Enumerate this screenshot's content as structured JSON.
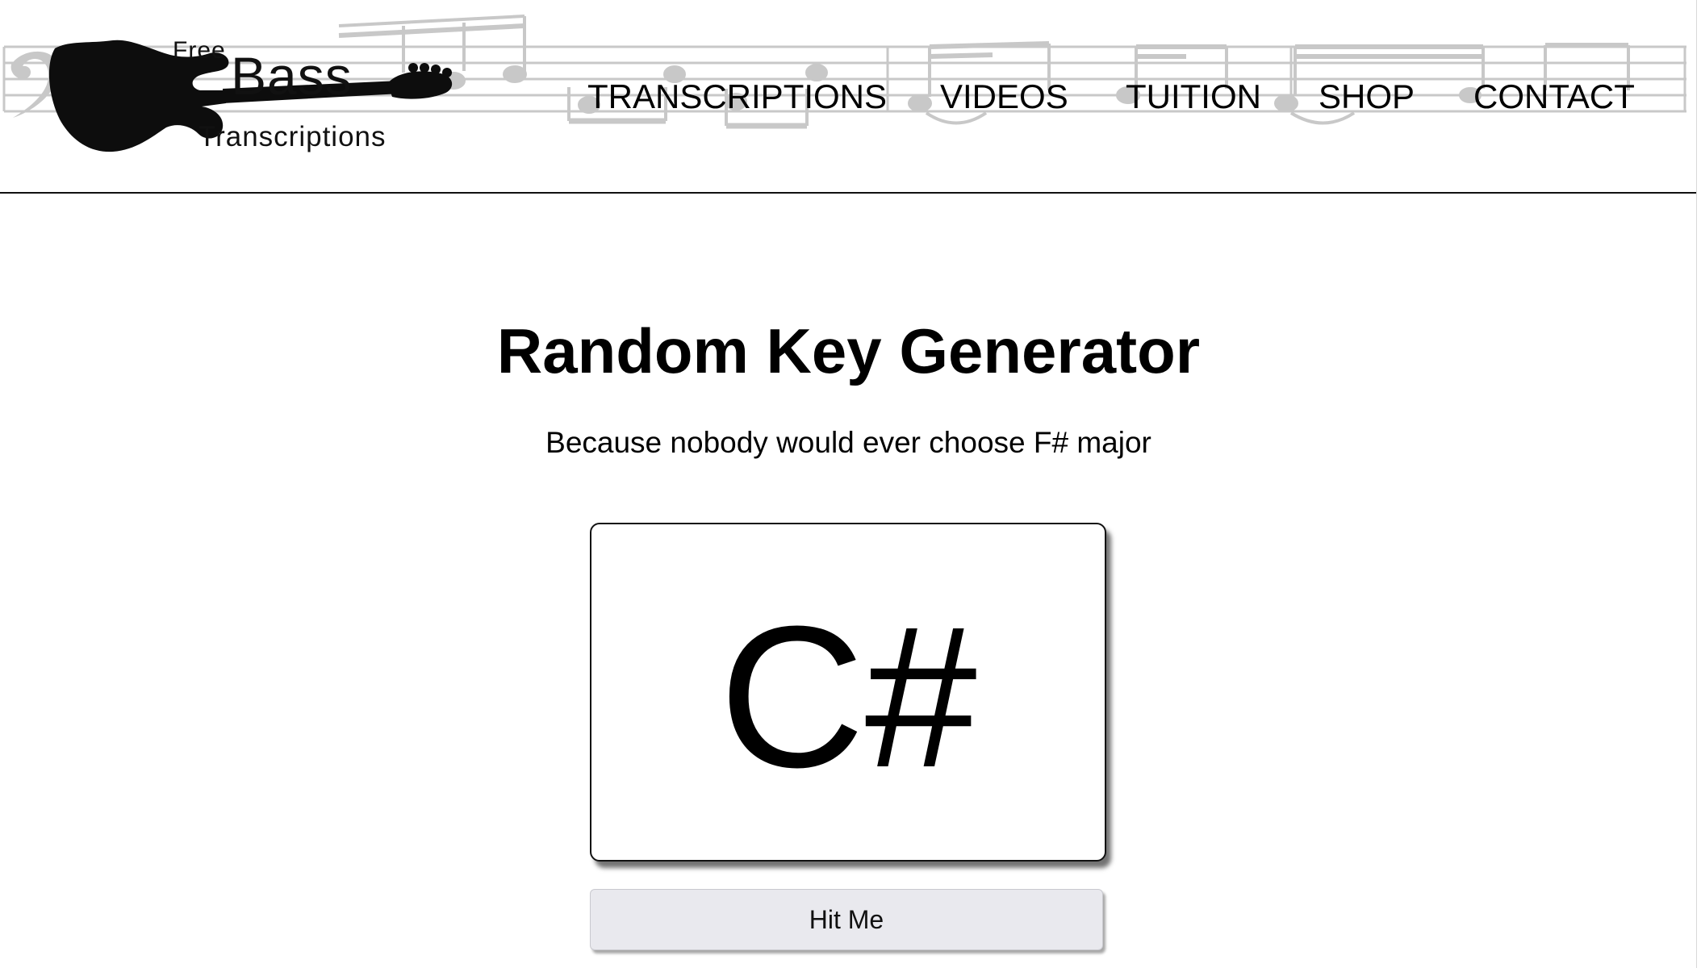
{
  "header": {
    "logo": {
      "free": "Free",
      "bass": "Bass",
      "transcriptions": "Transcriptions"
    },
    "nav": [
      {
        "label": "TRANSCRIPTIONS"
      },
      {
        "label": "VIDEOS"
      },
      {
        "label": "TUITION"
      },
      {
        "label": "SHOP"
      },
      {
        "label": "CONTACT"
      }
    ]
  },
  "main": {
    "title": "Random Key Generator",
    "subtitle": "Because nobody would ever choose F# major",
    "current_key": "C#",
    "button_label": "Hit Me"
  },
  "icons": {
    "logo_graphic": "bass-guitar-icon",
    "header_background": "music-staff-icon"
  },
  "colors": {
    "text": "#000000",
    "staff_gray": "#c8c8c8",
    "button_bg": "#e9e9ee",
    "page_bg": "#ffffff"
  }
}
